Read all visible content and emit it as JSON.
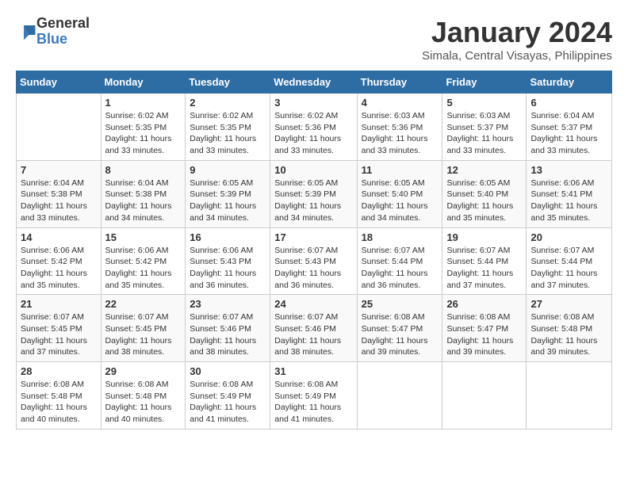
{
  "logo": {
    "general": "General",
    "blue": "Blue"
  },
  "title": "January 2024",
  "location": "Simala, Central Visayas, Philippines",
  "headers": [
    "Sunday",
    "Monday",
    "Tuesday",
    "Wednesday",
    "Thursday",
    "Friday",
    "Saturday"
  ],
  "weeks": [
    [
      {
        "day": "",
        "info": ""
      },
      {
        "day": "1",
        "info": "Sunrise: 6:02 AM\nSunset: 5:35 PM\nDaylight: 11 hours\nand 33 minutes."
      },
      {
        "day": "2",
        "info": "Sunrise: 6:02 AM\nSunset: 5:35 PM\nDaylight: 11 hours\nand 33 minutes."
      },
      {
        "day": "3",
        "info": "Sunrise: 6:02 AM\nSunset: 5:36 PM\nDaylight: 11 hours\nand 33 minutes."
      },
      {
        "day": "4",
        "info": "Sunrise: 6:03 AM\nSunset: 5:36 PM\nDaylight: 11 hours\nand 33 minutes."
      },
      {
        "day": "5",
        "info": "Sunrise: 6:03 AM\nSunset: 5:37 PM\nDaylight: 11 hours\nand 33 minutes."
      },
      {
        "day": "6",
        "info": "Sunrise: 6:04 AM\nSunset: 5:37 PM\nDaylight: 11 hours\nand 33 minutes."
      }
    ],
    [
      {
        "day": "7",
        "info": "Sunrise: 6:04 AM\nSunset: 5:38 PM\nDaylight: 11 hours\nand 33 minutes."
      },
      {
        "day": "8",
        "info": "Sunrise: 6:04 AM\nSunset: 5:38 PM\nDaylight: 11 hours\nand 34 minutes."
      },
      {
        "day": "9",
        "info": "Sunrise: 6:05 AM\nSunset: 5:39 PM\nDaylight: 11 hours\nand 34 minutes."
      },
      {
        "day": "10",
        "info": "Sunrise: 6:05 AM\nSunset: 5:39 PM\nDaylight: 11 hours\nand 34 minutes."
      },
      {
        "day": "11",
        "info": "Sunrise: 6:05 AM\nSunset: 5:40 PM\nDaylight: 11 hours\nand 34 minutes."
      },
      {
        "day": "12",
        "info": "Sunrise: 6:05 AM\nSunset: 5:40 PM\nDaylight: 11 hours\nand 35 minutes."
      },
      {
        "day": "13",
        "info": "Sunrise: 6:06 AM\nSunset: 5:41 PM\nDaylight: 11 hours\nand 35 minutes."
      }
    ],
    [
      {
        "day": "14",
        "info": "Sunrise: 6:06 AM\nSunset: 5:42 PM\nDaylight: 11 hours\nand 35 minutes."
      },
      {
        "day": "15",
        "info": "Sunrise: 6:06 AM\nSunset: 5:42 PM\nDaylight: 11 hours\nand 35 minutes."
      },
      {
        "day": "16",
        "info": "Sunrise: 6:06 AM\nSunset: 5:43 PM\nDaylight: 11 hours\nand 36 minutes."
      },
      {
        "day": "17",
        "info": "Sunrise: 6:07 AM\nSunset: 5:43 PM\nDaylight: 11 hours\nand 36 minutes."
      },
      {
        "day": "18",
        "info": "Sunrise: 6:07 AM\nSunset: 5:44 PM\nDaylight: 11 hours\nand 36 minutes."
      },
      {
        "day": "19",
        "info": "Sunrise: 6:07 AM\nSunset: 5:44 PM\nDaylight: 11 hours\nand 37 minutes."
      },
      {
        "day": "20",
        "info": "Sunrise: 6:07 AM\nSunset: 5:44 PM\nDaylight: 11 hours\nand 37 minutes."
      }
    ],
    [
      {
        "day": "21",
        "info": "Sunrise: 6:07 AM\nSunset: 5:45 PM\nDaylight: 11 hours\nand 37 minutes."
      },
      {
        "day": "22",
        "info": "Sunrise: 6:07 AM\nSunset: 5:45 PM\nDaylight: 11 hours\nand 38 minutes."
      },
      {
        "day": "23",
        "info": "Sunrise: 6:07 AM\nSunset: 5:46 PM\nDaylight: 11 hours\nand 38 minutes."
      },
      {
        "day": "24",
        "info": "Sunrise: 6:07 AM\nSunset: 5:46 PM\nDaylight: 11 hours\nand 38 minutes."
      },
      {
        "day": "25",
        "info": "Sunrise: 6:08 AM\nSunset: 5:47 PM\nDaylight: 11 hours\nand 39 minutes."
      },
      {
        "day": "26",
        "info": "Sunrise: 6:08 AM\nSunset: 5:47 PM\nDaylight: 11 hours\nand 39 minutes."
      },
      {
        "day": "27",
        "info": "Sunrise: 6:08 AM\nSunset: 5:48 PM\nDaylight: 11 hours\nand 39 minutes."
      }
    ],
    [
      {
        "day": "28",
        "info": "Sunrise: 6:08 AM\nSunset: 5:48 PM\nDaylight: 11 hours\nand 40 minutes."
      },
      {
        "day": "29",
        "info": "Sunrise: 6:08 AM\nSunset: 5:48 PM\nDaylight: 11 hours\nand 40 minutes."
      },
      {
        "day": "30",
        "info": "Sunrise: 6:08 AM\nSunset: 5:49 PM\nDaylight: 11 hours\nand 41 minutes."
      },
      {
        "day": "31",
        "info": "Sunrise: 6:08 AM\nSunset: 5:49 PM\nDaylight: 11 hours\nand 41 minutes."
      },
      {
        "day": "",
        "info": ""
      },
      {
        "day": "",
        "info": ""
      },
      {
        "day": "",
        "info": ""
      }
    ]
  ]
}
